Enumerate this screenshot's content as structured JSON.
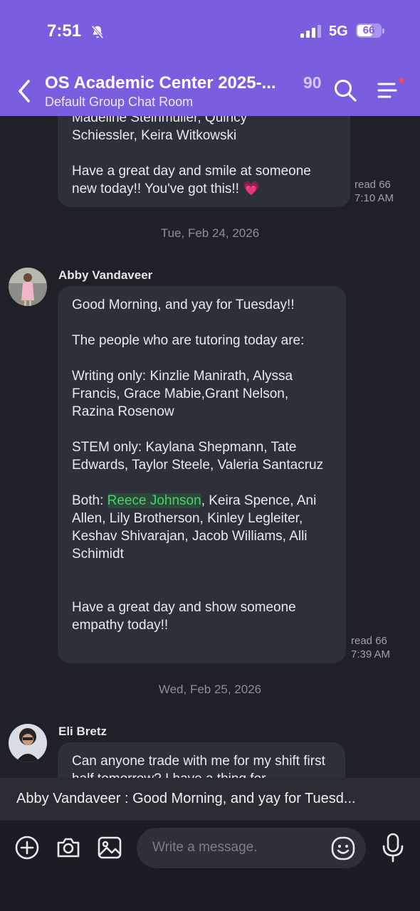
{
  "status_bar": {
    "time": "7:51",
    "network": "5G",
    "battery": "66",
    "battery_level": 0.66
  },
  "header": {
    "title": "OS Academic Center 2025-...",
    "member_count": "90",
    "subtitle": "Default Group Chat Room",
    "accent_color": "#7b5de0"
  },
  "messages": [
    {
      "partial_lines": [
        "Madeline Steinmuller, Quincy",
        "Schiessler, Keira Witkowski"
      ],
      "closing": "Have a great day and smile at someone new today!! You've got this!! 💗",
      "read": "read 66",
      "time": "7:10 AM"
    },
    {
      "date": "Tue, Feb 24, 2026",
      "sender": "Abby Vandaveer",
      "greeting": "Good Morning, and yay for Tuesday!!",
      "intro": "The people who are tutoring today are:",
      "writing": "Writing only: Kinzlie Manirath, Alyssa Francis, Grace Mabie,Grant Nelson, Razina Rosenow",
      "stem": "STEM only: Kaylana Shepmann, Tate Edwards, Taylor Steele, Valeria Santacruz",
      "both_prefix": "Both: ",
      "both_mention": "Reece Johnson",
      "both_rest": ", Keira Spence, Ani Allen, Lily Brotherson, Kinley Legleiter, Keshav Shivarajan, Jacob Williams, Alli Schimidt",
      "closing": "Have a great day and show someone empathy today!!",
      "read": "read 66",
      "time": "7:39 AM"
    },
    {
      "date": "Wed, Feb 25, 2026",
      "sender": "Eli Bretz",
      "text": "Can anyone trade with me for my shift first half tomorrow? I have a thing for"
    }
  ],
  "preview_bar": {
    "text": "Abby Vandaveer :  Good Morning, and yay for Tuesd..."
  },
  "input_bar": {
    "placeholder": "Write a message."
  }
}
